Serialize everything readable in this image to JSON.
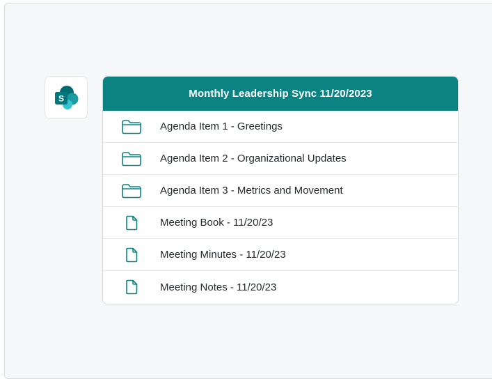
{
  "app": {
    "icon": "sharepoint-icon",
    "logo_letter": "S",
    "colors": {
      "dark": "#036c70",
      "mid": "#1a9ba1",
      "light": "#37c6d0"
    }
  },
  "card": {
    "title": "Monthly Leadership Sync 11/20/2023",
    "header_color": "#0b8383",
    "icon_color": "#0b8383",
    "items": [
      {
        "type": "folder",
        "icon": "folder-icon",
        "label": "Agenda Item 1 - Greetings"
      },
      {
        "type": "folder",
        "icon": "folder-icon",
        "label": "Agenda Item 2 - Organizational Updates"
      },
      {
        "type": "folder",
        "icon": "folder-icon",
        "label": "Agenda Item 3 - Metrics and Movement"
      },
      {
        "type": "file",
        "icon": "document-icon",
        "label": "Meeting Book - 11/20/23"
      },
      {
        "type": "file",
        "icon": "document-icon",
        "label": "Meeting Minutes - 11/20/23"
      },
      {
        "type": "file",
        "icon": "document-icon",
        "label": "Meeting Notes - 11/20/23"
      }
    ]
  }
}
